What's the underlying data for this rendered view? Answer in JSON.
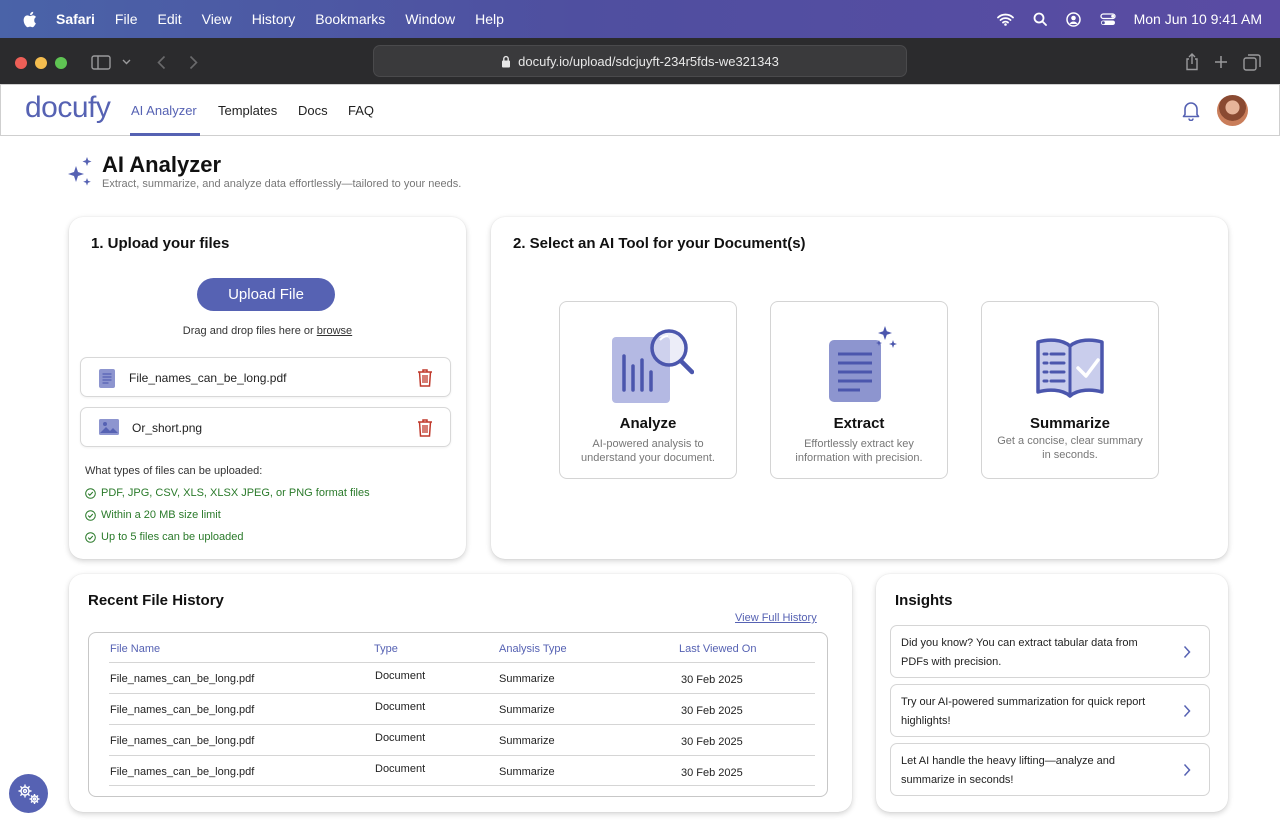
{
  "menubar": {
    "app": "Safari",
    "items": [
      "File",
      "Edit",
      "View",
      "History",
      "Bookmarks",
      "Window",
      "Help"
    ],
    "clock": "Mon Jun 10  9:41 AM"
  },
  "browser": {
    "url": "docufy.io/upload/sdcjuyft-234r5fds-we321343"
  },
  "nav": {
    "logo": "docufy",
    "links": [
      "AI Analyzer",
      "Templates",
      "Docs",
      "FAQ"
    ],
    "active": "AI Analyzer"
  },
  "page": {
    "title": "AI Analyzer",
    "subtitle": "Extract, summarize, and analyze data effortlessly—tailored to your needs."
  },
  "upload": {
    "title": "1. Upload your files",
    "button": "Upload File",
    "drag_prefix": "Drag and drop files here or ",
    "browse": "browse",
    "files": [
      {
        "name": "File_names_can_be_long.pdf",
        "kind": "document-icon"
      },
      {
        "name": "Or_short.png",
        "kind": "image-icon"
      }
    ],
    "types_heading": "What types of files can be uploaded:",
    "types": [
      "PDF, JPG, CSV, XLS, XLSX JPEG, or PNG format files",
      "Within a 20 MB size limit",
      "Up to 5 files can be uploaded"
    ]
  },
  "tools": {
    "title": "2. Select an AI Tool for your Document(s)",
    "items": [
      {
        "name": "Analyze",
        "desc": "AI-powered analysis to understand your document."
      },
      {
        "name": "Extract",
        "desc": "Effortlessly extract key information with precision."
      },
      {
        "name": "Summarize",
        "desc": "Get a concise, clear summary in seconds."
      }
    ]
  },
  "recent": {
    "title": "Recent File History",
    "view_full": "View Full History",
    "columns": [
      "File Name",
      "Type",
      "Analysis Type",
      "Last Viewed On"
    ],
    "rows": [
      [
        "File_names_can_be_long.pdf",
        "Document",
        "Summarize",
        "30 Feb 2025"
      ],
      [
        "File_names_can_be_long.pdf",
        "Document",
        "Summarize",
        "30 Feb 2025"
      ],
      [
        "File_names_can_be_long.pdf",
        "Document",
        "Summarize",
        "30 Feb 2025"
      ],
      [
        "File_names_can_be_long.pdf",
        "Document",
        "Summarize",
        "30 Feb 2025"
      ]
    ]
  },
  "insights": {
    "title": "Insights",
    "items": [
      "Did you know? You can extract tabular data from PDFs with precision.",
      "Try our AI-powered summarization for quick report highlights!",
      "Let AI handle the heavy lifting—analyze and summarize in seconds!"
    ]
  },
  "colors": {
    "accent": "#5662b3",
    "success": "#2a7a2a",
    "danger": "#c0392b"
  }
}
